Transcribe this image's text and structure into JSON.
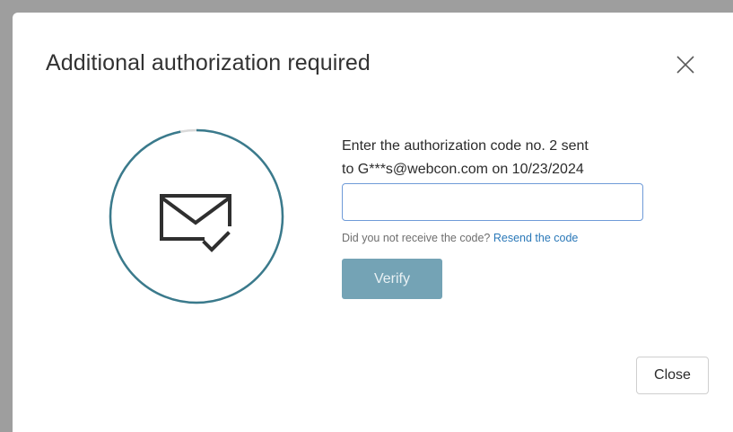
{
  "dialog": {
    "title": "Additional authorization required",
    "close_icon": "close-icon",
    "instruction_line1": "Enter the authorization code no. 2 sent",
    "instruction_line2": "to G***s@webcon.com on 10/23/2024",
    "code_input": {
      "value": "",
      "placeholder": ""
    },
    "resend_prompt": "Did you not receive the code?",
    "resend_link": "Resend the code",
    "verify_label": "Verify",
    "close_label": "Close",
    "timer_progress": 0.97,
    "icons": {
      "timer": "countdown-ring-icon",
      "envelope": "envelope-check-icon"
    }
  },
  "colors": {
    "ring": "#3a7a8c",
    "ring_track": "#d9d9d9",
    "verify_button": "#74a3b5",
    "link": "#2a78b8",
    "input_border": "#6f9bd8"
  }
}
